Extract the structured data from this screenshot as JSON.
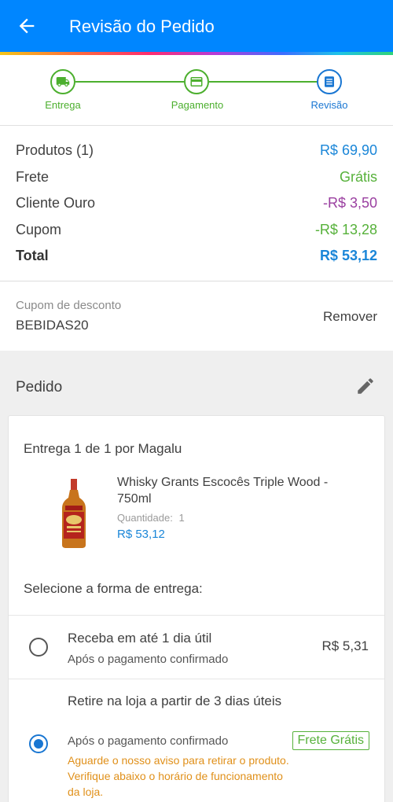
{
  "header": {
    "title": "Revisão do Pedido",
    "back_icon": "arrow-left-icon"
  },
  "stepper": {
    "steps": [
      {
        "label": "Entrega",
        "icon": "truck-icon",
        "state": "done"
      },
      {
        "label": "Pagamento",
        "icon": "card-icon",
        "state": "done"
      },
      {
        "label": "Revisão",
        "icon": "list-icon",
        "state": "active"
      }
    ],
    "colors": {
      "done": "#4caf2e",
      "active": "#1976d2"
    }
  },
  "summary": {
    "rows": [
      {
        "label": "Produtos (1)",
        "value": "R$ 69,90"
      },
      {
        "label": "Frete",
        "value": "Grátis"
      },
      {
        "label": "Cliente Ouro",
        "value": "-R$ 3,50"
      },
      {
        "label": "Cupom",
        "value": "-R$ 13,28"
      },
      {
        "label": "Total",
        "value": "R$ 53,12"
      }
    ]
  },
  "coupon": {
    "label": "Cupom de desconto",
    "code": "BEBIDAS20",
    "remove": "Remover"
  },
  "order": {
    "title": "Pedido",
    "delivery_head": "Entrega 1 de 1 por Magalu",
    "product": {
      "name": "Whisky Grants Escocês Triple Wood - 750ml",
      "qty_label": "Quantidade:",
      "qty_value": "1",
      "price": "R$ 53,12"
    },
    "select_head": "Selecione a forma de entrega:",
    "options": [
      {
        "title": "Receba em até 1 dia útil",
        "sub": "Após o pagamento confirmado",
        "price": "R$ 5,31",
        "selected": false
      },
      {
        "title": "Retire na loja a partir de 3 dias úteis",
        "sub": "Após o pagamento confirmado",
        "badge": "Frete Grátis",
        "warning": "Aguarde o nosso aviso para retirar o produto. Verifique abaixo o horário de funcionamento da loja.",
        "selected": true
      }
    ]
  },
  "colors": {
    "brand": "#0086ff",
    "price_blue": "#1a86d8",
    "green": "#56b13a",
    "purple": "#9a3fa0",
    "warning": "#e0901a"
  }
}
